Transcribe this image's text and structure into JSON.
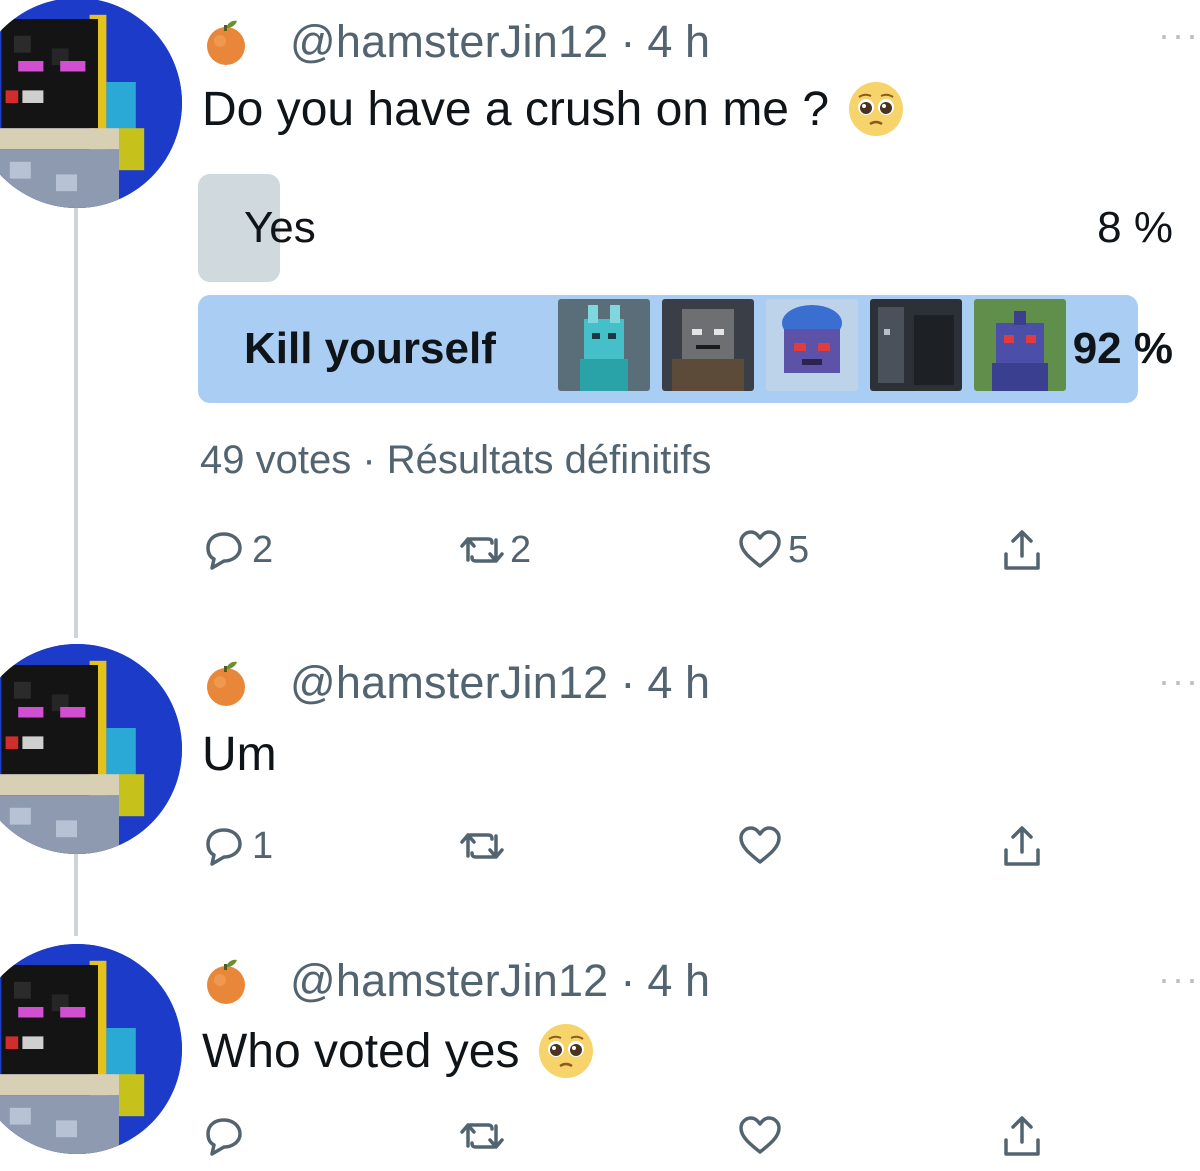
{
  "tweets": [
    {
      "handle": "@hamsterJin12",
      "separator": "·",
      "time": "4 h",
      "more": "···",
      "text": "Do you have a crush on me ?",
      "emoji": "pleading-face",
      "poll": {
        "options": [
          {
            "label": "Yes",
            "percent_label": "8 %",
            "percent": 8,
            "leading": false
          },
          {
            "label": "Kill yourself",
            "percent_label": "92 %",
            "percent": 92,
            "leading": true
          }
        ],
        "votes": "49 votes",
        "meta_separator": "·",
        "status": "Résultats définitifs"
      },
      "actions": {
        "replies": "2",
        "retweets": "2",
        "likes": "5"
      }
    },
    {
      "handle": "@hamsterJin12",
      "separator": "·",
      "time": "4 h",
      "more": "···",
      "text": "Um",
      "actions": {
        "replies": "1",
        "retweets": "",
        "likes": ""
      }
    },
    {
      "handle": "@hamsterJin12",
      "separator": "·",
      "time": "4 h",
      "more": "···",
      "text": "Who voted yes",
      "emoji": "pleading-face",
      "actions": {
        "replies": "",
        "retweets": "",
        "likes": ""
      }
    }
  ],
  "colors": {
    "poll_leading": "#a9cdf3",
    "poll_other": "#cfd9de",
    "secondary_text": "#536471",
    "avatar_bg": "#1d3bc9"
  }
}
